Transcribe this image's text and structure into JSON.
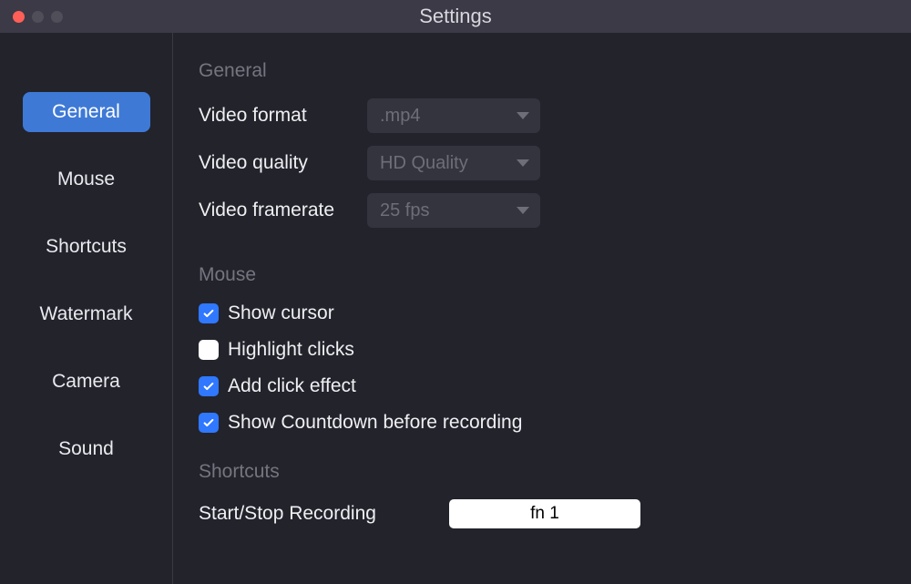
{
  "window": {
    "title": "Settings"
  },
  "sidebar": {
    "items": [
      {
        "label": "General",
        "active": true
      },
      {
        "label": "Mouse",
        "active": false
      },
      {
        "label": "Shortcuts",
        "active": false
      },
      {
        "label": "Watermark",
        "active": false
      },
      {
        "label": "Camera",
        "active": false
      },
      {
        "label": "Sound",
        "active": false
      }
    ]
  },
  "sections": {
    "general": {
      "heading": "General",
      "video_format": {
        "label": "Video format",
        "value": ".mp4"
      },
      "video_quality": {
        "label": "Video quality",
        "value": "HD Quality"
      },
      "video_framerate": {
        "label": "Video framerate",
        "value": "25 fps"
      }
    },
    "mouse": {
      "heading": "Mouse",
      "show_cursor": {
        "label": "Show cursor",
        "checked": true
      },
      "highlight_clicks": {
        "label": "Highlight clicks",
        "checked": false
      },
      "add_click_effect": {
        "label": "Add click effect",
        "checked": true
      },
      "show_countdown": {
        "label": "Show Countdown before recording",
        "checked": true
      }
    },
    "shortcuts": {
      "heading": "Shortcuts",
      "start_stop": {
        "label": "Start/Stop Recording",
        "value": "fn 1"
      }
    }
  }
}
